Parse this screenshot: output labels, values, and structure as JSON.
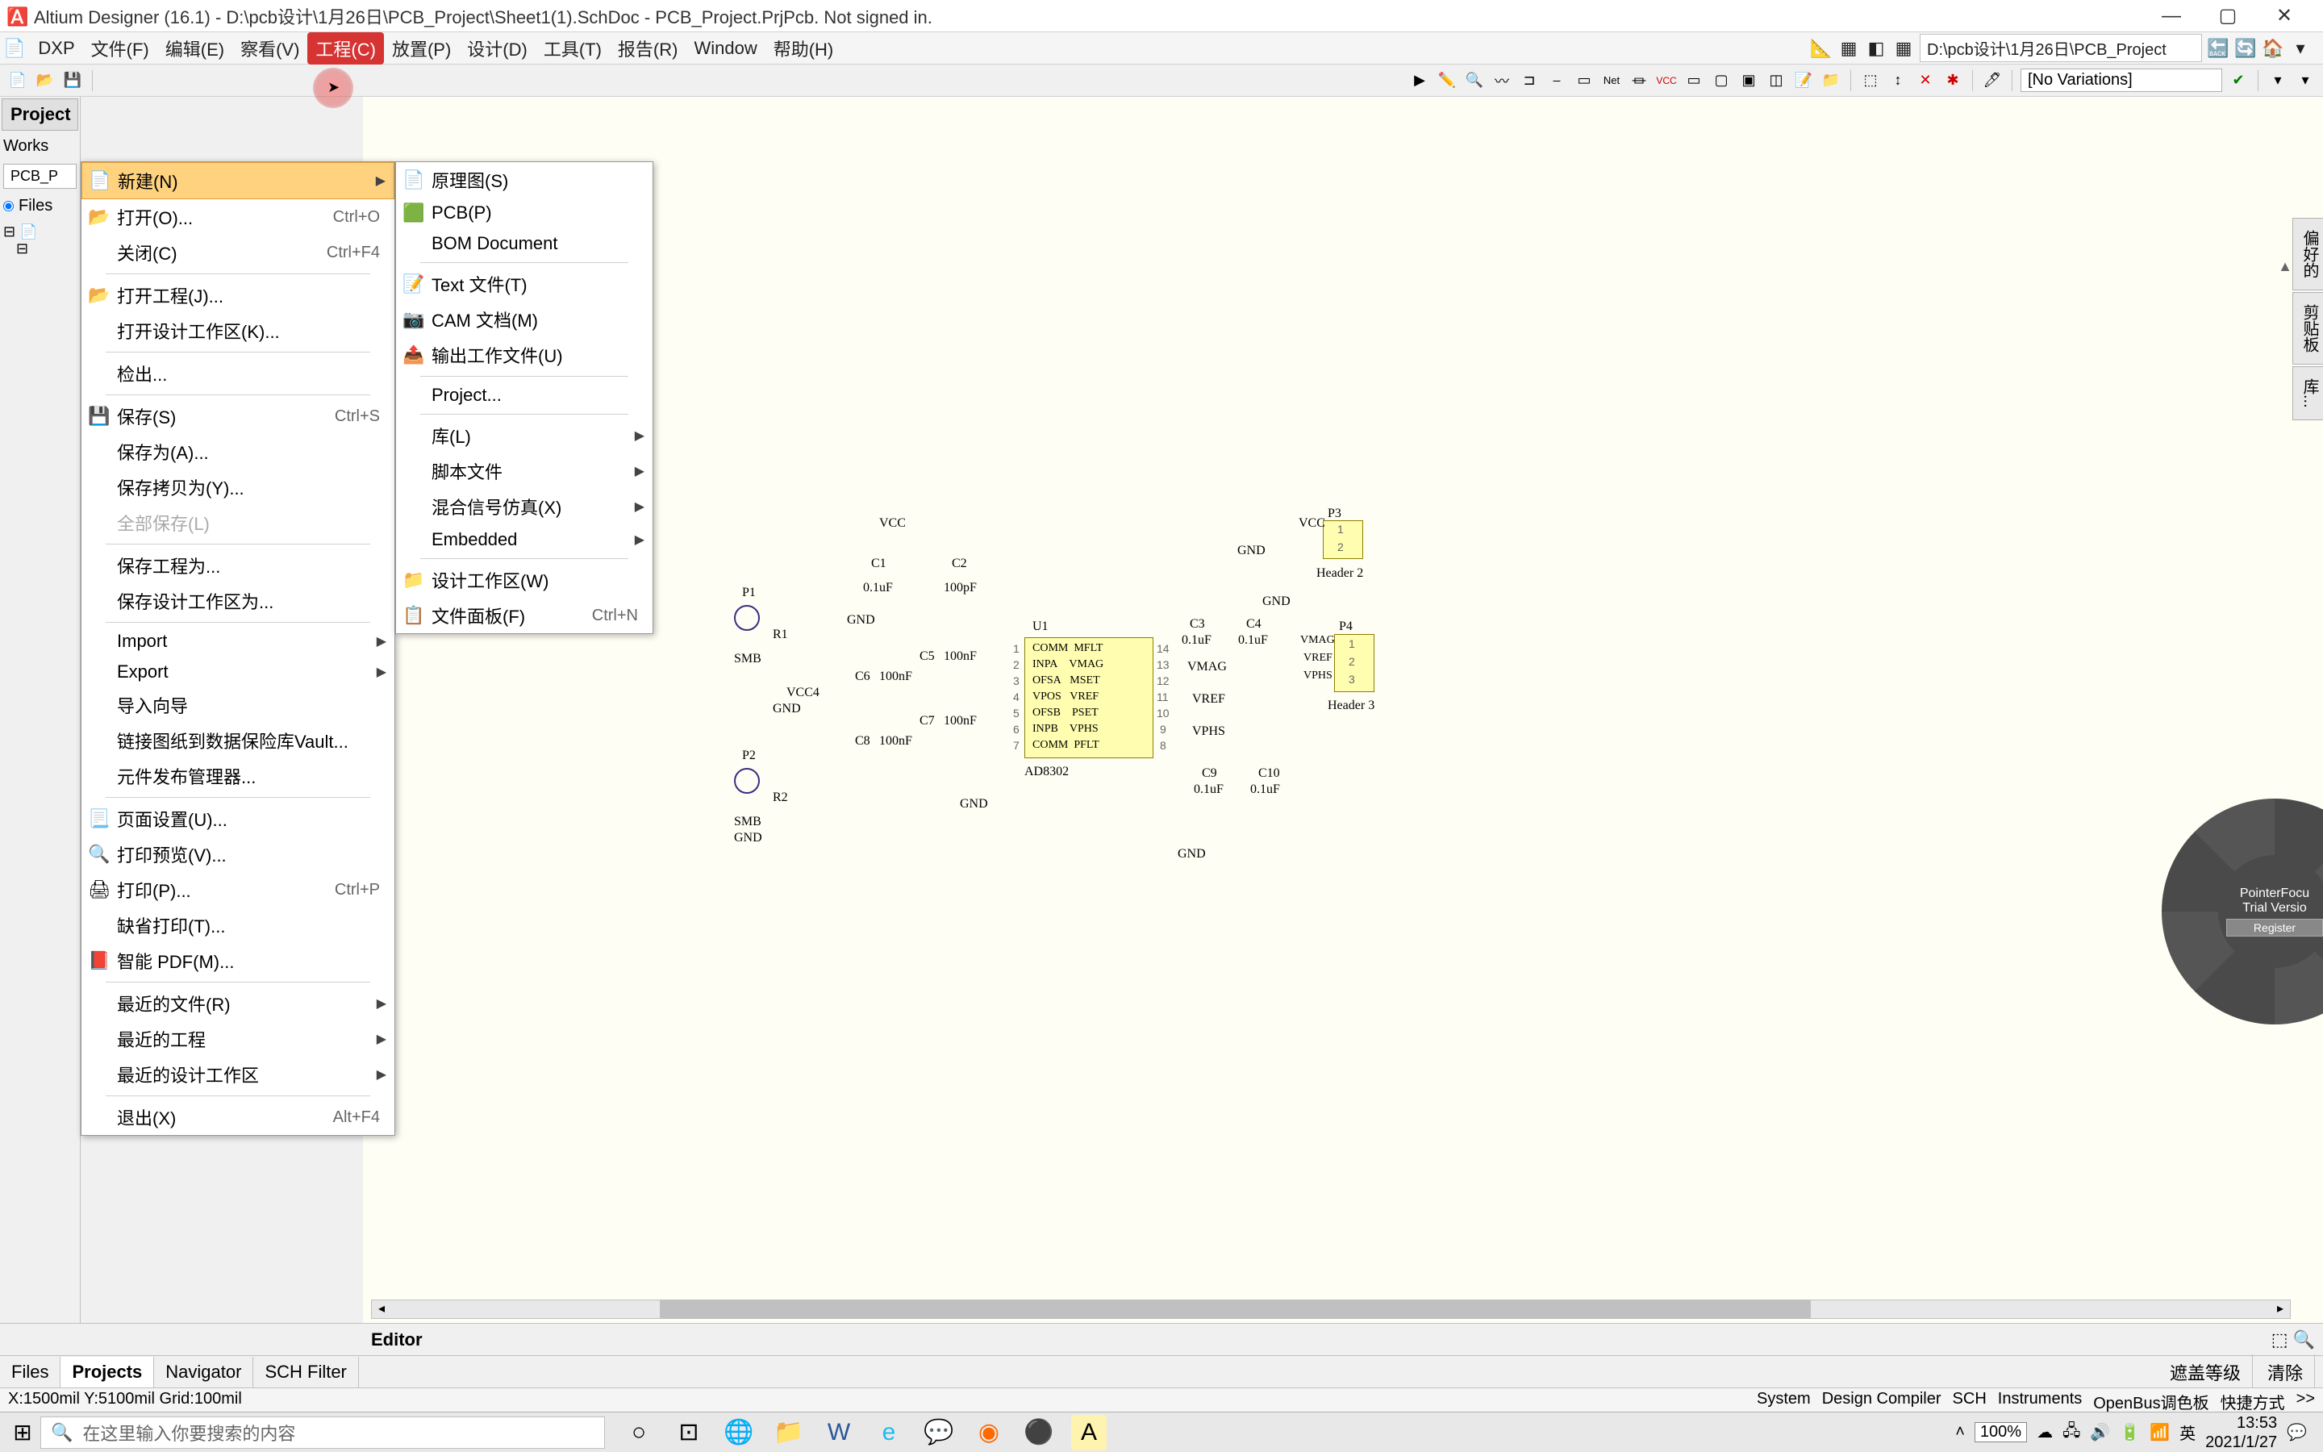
{
  "titlebar": {
    "text": "Altium Designer (16.1) - D:\\pcb设计\\1月26日\\PCB_Project\\Sheet1(1).SchDoc - PCB_Project.PrjPcb. Not signed in."
  },
  "menubar": {
    "items": [
      "DXP",
      "文件(F)",
      "编辑(E)",
      "察看(V)",
      "工程(C)",
      "放置(P)",
      "设计(D)",
      "工具(T)",
      "报告(R)",
      "Window",
      "帮助(H)"
    ],
    "path_box": "D:\\pcb设计\\1月26日\\PCB_Project"
  },
  "toolbar": {
    "variations": "[No Variations]"
  },
  "left_panel": {
    "title": "Project",
    "workspace": "Works",
    "doc_tab": "PCB_P",
    "files_radio": "Files"
  },
  "file_menu": {
    "items": [
      {
        "icon": "new",
        "label": "新建(N)",
        "shortcut": "",
        "arrow": true,
        "highlighted": true
      },
      {
        "icon": "open",
        "label": "打开(O)...",
        "shortcut": "Ctrl+O"
      },
      {
        "icon": "",
        "label": "关闭(C)",
        "shortcut": "Ctrl+F4"
      },
      {
        "sep": true
      },
      {
        "icon": "open",
        "label": "打开工程(J)...",
        "shortcut": ""
      },
      {
        "icon": "",
        "label": "打开设计工作区(K)...",
        "shortcut": ""
      },
      {
        "sep": true
      },
      {
        "icon": "",
        "label": "检出...",
        "shortcut": ""
      },
      {
        "sep": true
      },
      {
        "icon": "save",
        "label": "保存(S)",
        "shortcut": "Ctrl+S"
      },
      {
        "icon": "",
        "label": "保存为(A)...",
        "shortcut": ""
      },
      {
        "icon": "",
        "label": "保存拷贝为(Y)...",
        "shortcut": ""
      },
      {
        "icon": "",
        "label": "全部保存(L)",
        "shortcut": "",
        "disabled": true
      },
      {
        "sep": true
      },
      {
        "icon": "",
        "label": "保存工程为...",
        "shortcut": ""
      },
      {
        "icon": "",
        "label": "保存设计工作区为...",
        "shortcut": ""
      },
      {
        "sep": true
      },
      {
        "icon": "",
        "label": "Import",
        "arrow": true
      },
      {
        "icon": "",
        "label": "Export",
        "arrow": true
      },
      {
        "icon": "",
        "label": "导入向导"
      },
      {
        "icon": "",
        "label": "链接图纸到数据保险库Vault..."
      },
      {
        "icon": "",
        "label": "元件发布管理器..."
      },
      {
        "sep": true
      },
      {
        "icon": "page",
        "label": "页面设置(U)..."
      },
      {
        "icon": "preview",
        "label": "打印预览(V)..."
      },
      {
        "icon": "print",
        "label": "打印(P)...",
        "shortcut": "Ctrl+P"
      },
      {
        "icon": "",
        "label": "缺省打印(T)..."
      },
      {
        "icon": "pdf",
        "label": "智能 PDF(M)..."
      },
      {
        "sep": true
      },
      {
        "icon": "",
        "label": "最近的文件(R)",
        "arrow": true
      },
      {
        "icon": "",
        "label": "最近的工程",
        "arrow": true
      },
      {
        "icon": "",
        "label": "最近的设计工作区",
        "arrow": true
      },
      {
        "sep": true
      },
      {
        "icon": "",
        "label": "退出(X)",
        "shortcut": "Alt+F4"
      }
    ]
  },
  "sub_menu": {
    "items": [
      {
        "icon": "sch",
        "label": "原理图(S)"
      },
      {
        "icon": "pcb",
        "label": "PCB(P)"
      },
      {
        "icon": "",
        "label": "BOM Document"
      },
      {
        "sep": true
      },
      {
        "icon": "txt",
        "label": "Text 文件(T)"
      },
      {
        "icon": "cam",
        "label": "CAM 文档(M)"
      },
      {
        "icon": "out",
        "label": "输出工作文件(U)"
      },
      {
        "sep": true
      },
      {
        "icon": "",
        "label": "Project..."
      },
      {
        "sep": true
      },
      {
        "icon": "",
        "label": "库(L)",
        "arrow": true
      },
      {
        "icon": "",
        "label": "脚本文件",
        "arrow": true
      },
      {
        "icon": "",
        "label": "混合信号仿真(X)",
        "arrow": true
      },
      {
        "icon": "",
        "label": "Embedded",
        "arrow": true
      },
      {
        "sep": true
      },
      {
        "icon": "wsp",
        "label": "设计工作区(W)"
      },
      {
        "icon": "panel",
        "label": "文件面板(F)",
        "shortcut": "Ctrl+N"
      }
    ]
  },
  "right_tabs": {
    "items": [
      "偏好的",
      "剪贴板",
      "库..."
    ]
  },
  "radial": {
    "line1": "PointerFocu",
    "line2": "Trial Versio",
    "button": "Register"
  },
  "bottom_tabs": {
    "items": [
      "Files",
      "Projects",
      "Navigator",
      "SCH Filter"
    ],
    "editor": "Editor",
    "right_items": [
      "遮盖等级",
      "清除"
    ]
  },
  "status": {
    "left": "X:1500mil Y:5100mil   Grid:100mil",
    "right": [
      "System",
      "Design Compiler",
      "SCH",
      "Instruments",
      "OpenBus调色板",
      "快捷方式",
      ">>"
    ]
  },
  "taskbar": {
    "search_placeholder": "在这里输入你要搜索的内容",
    "zoom": "100%",
    "ime": "英",
    "time": "13:53",
    "date": "2021/1/27"
  },
  "schematic": {
    "u1_ref": "U1",
    "u1_type": "AD8302",
    "u1_pins_left": [
      "COMM",
      "INPA",
      "OFSA",
      "VPOS",
      "OFSB",
      "INPB",
      "COMM"
    ],
    "u1_pins_right": [
      "MFLT",
      "VMAG",
      "MSET",
      "VREF",
      "PSET",
      "VPHS",
      "PFLT"
    ],
    "p1": "P1",
    "p2": "P2",
    "p3": "P3",
    "p4": "P4",
    "smb": "SMB",
    "header2": "Header 2",
    "header3": "Header 3",
    "vcc": "VCC",
    "vcc4": "VCC4",
    "gnd": "GND",
    "vmag": "VMAG",
    "vref": "VREF",
    "vphs": "VPHS",
    "c1": "C1",
    "c1v": "0.1uF",
    "c2": "C2",
    "c2v": "100pF",
    "c3": "C3",
    "c3v": "0.1uF",
    "c4": "C4",
    "c4v": "0.1uF",
    "c5": "C5",
    "c5v": "100nF",
    "c6": "C6",
    "c6v": "100nF",
    "c7": "C7",
    "c7v": "100nF",
    "c8": "C8",
    "c8v": "100nF",
    "c9": "C9",
    "c9v": "0.1uF",
    "c10": "C10",
    "c10v": "0.1uF",
    "r1": "R1",
    "r2": "R2"
  }
}
